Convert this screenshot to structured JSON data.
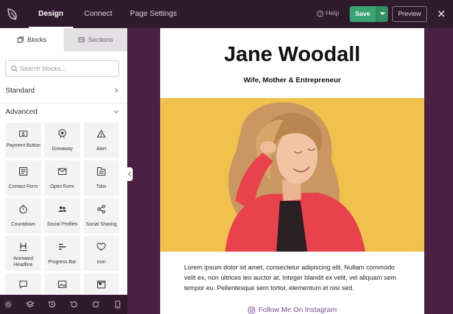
{
  "topbar": {
    "tabs": [
      {
        "label": "Design"
      },
      {
        "label": "Connect"
      },
      {
        "label": "Page Settings"
      }
    ],
    "help_label": "Help",
    "save_label": "Save",
    "preview_label": "Preview"
  },
  "sidebar": {
    "tabs": [
      {
        "label": "Blocks"
      },
      {
        "label": "Sections"
      }
    ],
    "search_placeholder": "Search blocks...",
    "categories": {
      "standard": "Standard",
      "advanced": "Advanced"
    },
    "blocks": [
      {
        "label": "Payment Button",
        "icon": "dollar-icon"
      },
      {
        "label": "Giveaway",
        "icon": "giveaway-icon"
      },
      {
        "label": "Alert",
        "icon": "alert-icon"
      },
      {
        "label": "Contact Form",
        "icon": "contact-form-icon"
      },
      {
        "label": "Optin Form",
        "icon": "mail-icon"
      },
      {
        "label": "Tabs",
        "icon": "tabs-icon"
      },
      {
        "label": "Countdown",
        "icon": "stopwatch-icon"
      },
      {
        "label": "Social Profiles",
        "icon": "users-icon"
      },
      {
        "label": "Social Sharing",
        "icon": "share-icon"
      },
      {
        "label": "Animated Headline",
        "icon": "headline-icon"
      },
      {
        "label": "Progress Bar",
        "icon": "progress-bar-icon"
      },
      {
        "label": "Icon",
        "icon": "heart-icon"
      }
    ]
  },
  "page": {
    "title": "Jane Woodall",
    "subtitle": "Wife, Mother & Entrepreneur",
    "body": "Lorem ipsum dolor sit amet, consectetur adipiscing elit. Nullam commodo velit ex, non ultrices leo auctor at. Integer blandit ex velit, vel aliquam sem tempor eu. Pellentesque sem tortor, elementum et nisi sed.",
    "follow_label": "Follow Me On Instagram"
  },
  "colors": {
    "topbar": "#2e1a2c",
    "canvas_bg": "#4a2142",
    "save_green": "#3aa371",
    "hero_yellow": "#f1c14d",
    "jacket_red": "#e8434c",
    "link_purple": "#7b4fa0"
  }
}
